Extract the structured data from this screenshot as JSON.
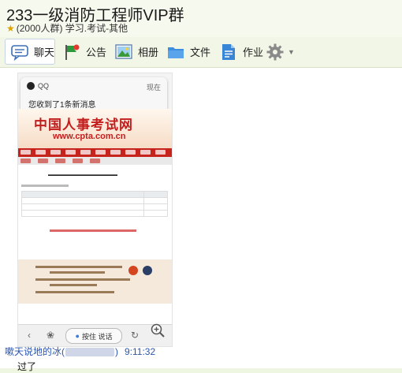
{
  "header": {
    "title": "233一级消防工程师VIP群",
    "subtitle": "(2000人群) 学习.考试-其他"
  },
  "toolbar": {
    "items": [
      {
        "label": "聊天",
        "icon": "chat-icon"
      },
      {
        "label": "公告",
        "icon": "announcement-icon"
      },
      {
        "label": "相册",
        "icon": "photo-icon"
      },
      {
        "label": "文件",
        "icon": "folder-icon"
      },
      {
        "label": "作业",
        "icon": "homework-icon"
      },
      {
        "label": "",
        "icon": "gear-icon"
      }
    ]
  },
  "messages": [
    {
      "sender": "嗽天说地的冰(",
      "sender_close": ")",
      "time": "9:11:32",
      "text": "过了"
    }
  ],
  "screenshot": {
    "notification": {
      "app": "QQ",
      "time": "现在",
      "text": "您收到了1条新消息"
    },
    "site_title": "中国人事考试网",
    "site_url": "www.cpta.com.cn",
    "voice_button": "按住 说话"
  },
  "colors": {
    "accent": "#2a55b0",
    "background": "#eef5e1",
    "site_red": "#c7231d"
  }
}
